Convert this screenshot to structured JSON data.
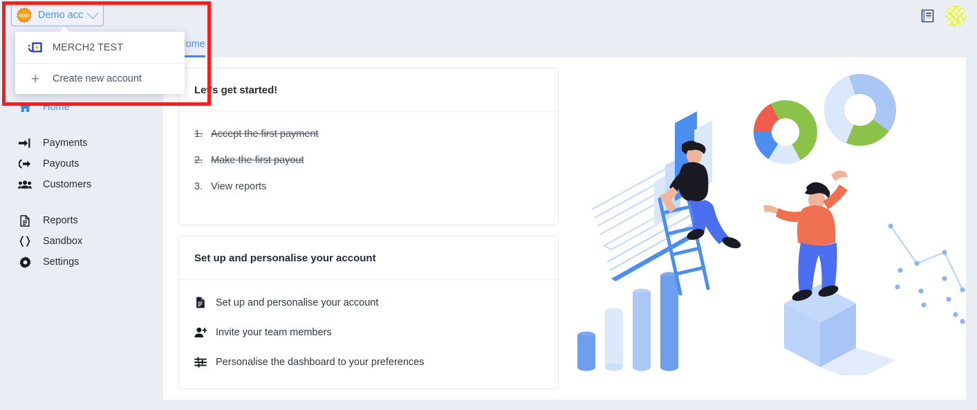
{
  "app": {
    "accent_blue": "#3d8ae4",
    "background": "#eaedf4",
    "panel": "#ffffff",
    "annotation_color": "#f71d1d"
  },
  "account_switcher": {
    "label": "Demo acc",
    "badge_text": "DEMO",
    "badge_icon": "demo-starburst-badge-icon",
    "chevron_icon": "chevron-down-icon",
    "expanded": true
  },
  "account_dropdown": {
    "items": [
      {
        "label": "MERCH2 TEST",
        "icon": "merchant-logo-icon"
      },
      {
        "label": "Create new account",
        "icon": "plus-icon"
      }
    ]
  },
  "sidebar": {
    "groups": [
      {
        "items": [
          {
            "label": "Home",
            "icon": "home-icon",
            "active": true
          }
        ]
      },
      {
        "items": [
          {
            "label": "Payments",
            "icon": "payments-arrow-in-icon",
            "active": false
          },
          {
            "label": "Payouts",
            "icon": "payouts-arrow-out-icon",
            "active": false
          },
          {
            "label": "Customers",
            "icon": "customers-people-icon",
            "active": false
          }
        ]
      },
      {
        "items": [
          {
            "label": "Reports",
            "icon": "reports-document-icon",
            "active": false
          },
          {
            "label": "Sandbox",
            "icon": "sandbox-braces-icon",
            "active": false
          },
          {
            "label": "Settings",
            "icon": "settings-gear-icon",
            "active": false
          }
        ]
      }
    ]
  },
  "topbar": {
    "docs_icon": "documentation-book-icon",
    "avatar_icon": "user-avatar-identicon"
  },
  "tabs": [
    {
      "label": "Home",
      "active": true
    }
  ],
  "cards": [
    {
      "id": "lets-get-started",
      "title": "Let's get started!",
      "steps": [
        {
          "num": "1.",
          "label": "Accept the first payment",
          "done": true
        },
        {
          "num": "2.",
          "label": "Make the first payout",
          "done": true
        },
        {
          "num": "3.",
          "label": "View reports",
          "done": false
        }
      ]
    },
    {
      "id": "set-up-and-personalise",
      "title": "Set up and personalise your account",
      "actions": [
        {
          "label": "Set up and personalise your account",
          "icon": "document-icon"
        },
        {
          "label": "Invite your team members",
          "icon": "user-plus-icon"
        },
        {
          "label": "Personalise the dashboard to your preferences",
          "icon": "sliders-icon"
        }
      ]
    }
  ],
  "illustration": {
    "name": "analytics-onboarding-illustration",
    "description": "Isometric illustration: woman climbing ladder next to bar charts, man on pedestal holding donut charts"
  }
}
